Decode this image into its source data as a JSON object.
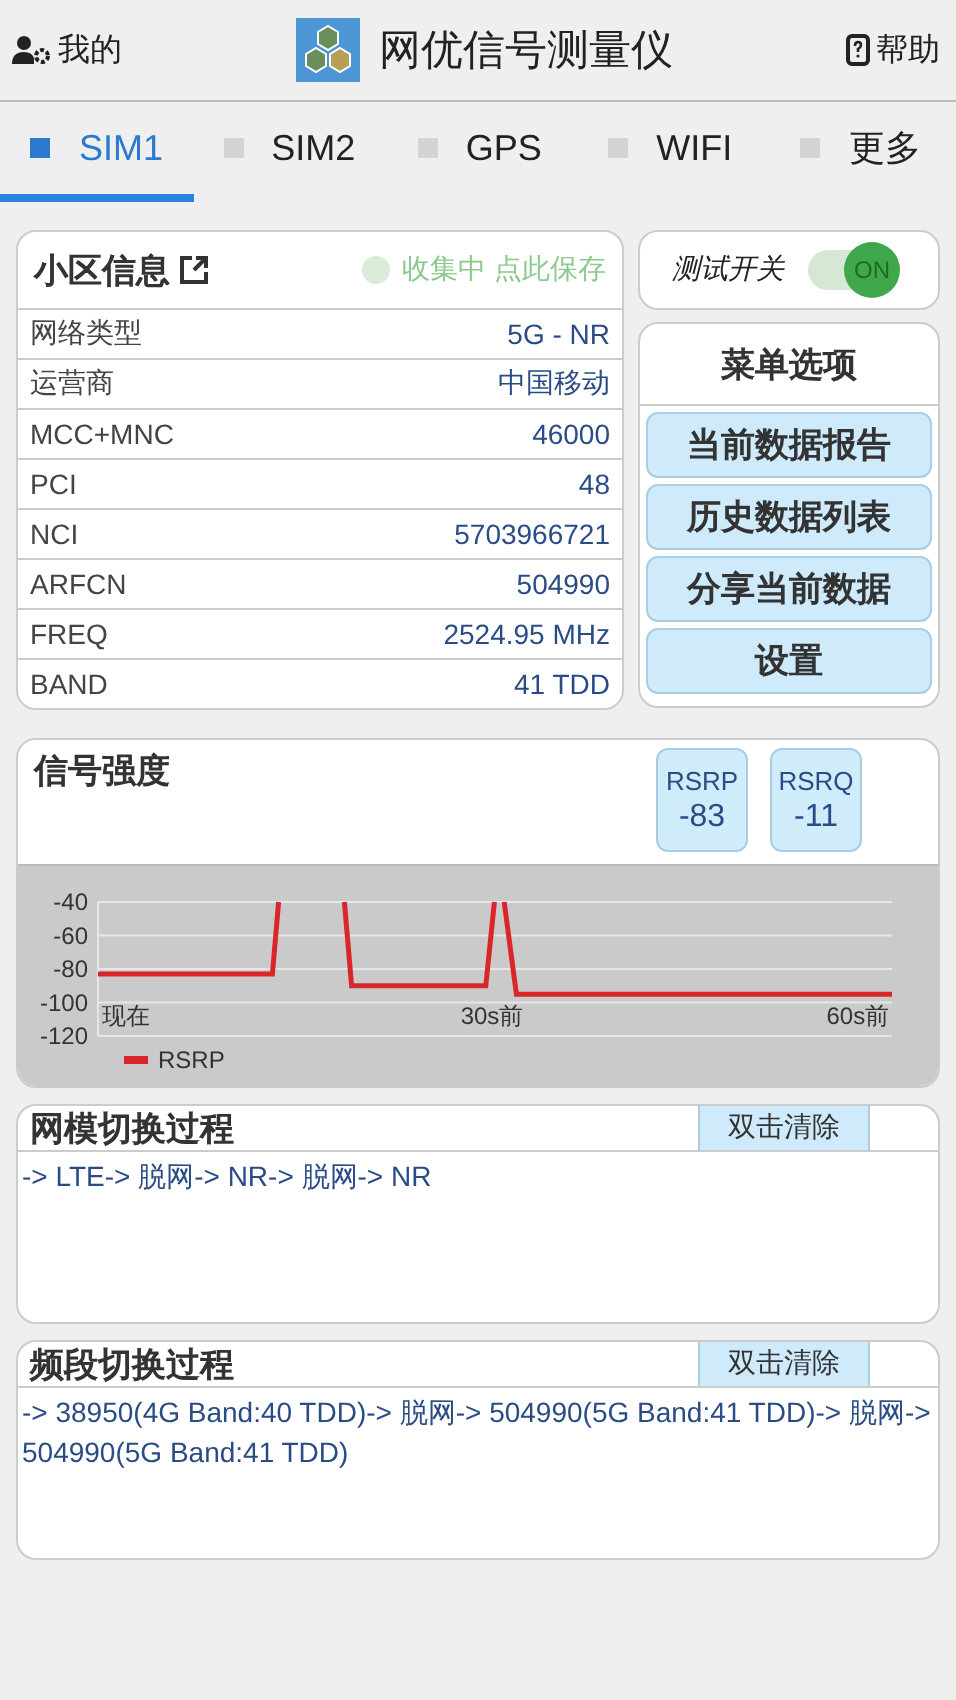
{
  "header": {
    "account": {
      "label": "我的"
    },
    "title": "网优信号测量仪",
    "help": {
      "label": "帮助"
    }
  },
  "tabs": [
    {
      "label": "SIM1",
      "selected": true
    },
    {
      "label": "SIM2",
      "selected": false
    },
    {
      "label": "GPS",
      "selected": false
    },
    {
      "label": "WIFI",
      "selected": false
    },
    {
      "label": "更多",
      "selected": false
    }
  ],
  "cell_info": {
    "title": "小区信息",
    "status": "收集中 点此保存",
    "rows": [
      {
        "label": "网络类型",
        "value": "5G - NR"
      },
      {
        "label": "运营商",
        "value": "中国移动"
      },
      {
        "label": "MCC+MNC",
        "value": "46000"
      },
      {
        "label": "PCI",
        "value": "48"
      },
      {
        "label": "NCI",
        "value": "5703966721"
      },
      {
        "label": "ARFCN",
        "value": "504990"
      },
      {
        "label": "FREQ",
        "value": "2524.95 MHz"
      },
      {
        "label": "BAND",
        "value": "41 TDD"
      }
    ]
  },
  "test_switch": {
    "label": "测试开关",
    "on": true,
    "state_text": "ON"
  },
  "menu": {
    "title": "菜单选项",
    "items": [
      "当前数据报告",
      "历史数据列表",
      "分享当前数据",
      "设置"
    ]
  },
  "signal": {
    "title": "信号强度",
    "readings": [
      {
        "name": "RSRP",
        "value": "-83"
      },
      {
        "name": "RSRQ",
        "value": "-11"
      }
    ],
    "chart_data": {
      "type": "line",
      "grid": true,
      "x": [
        -2.3,
        12,
        12.5,
        17.9,
        18.5,
        29.5,
        30.2,
        31,
        32,
        62.8
      ],
      "series": [
        {
          "name": "RSRP",
          "color": "#d9262b",
          "values": [
            -83,
            -83,
            -40,
            -40,
            -90,
            -90,
            -40,
            -40,
            -95,
            -95
          ]
        }
      ],
      "xlim": [
        -2.3,
        62.8
      ],
      "ylim": [
        -120,
        -40
      ],
      "yticks": [
        -40,
        -60,
        -80,
        -100,
        -120
      ],
      "xticks": [
        {
          "value": 0,
          "label": "现在"
        },
        {
          "value": 30,
          "label": "30s前"
        },
        {
          "value": 60,
          "label": "60s前"
        }
      ]
    }
  },
  "mode_log": {
    "title": "网模切换过程",
    "clear_button": "双击清除",
    "text": "-> LTE-> 脱网-> NR-> 脱网-> NR"
  },
  "band_log": {
    "title": "频段切换过程",
    "clear_button": "双击清除",
    "text": "-> 38950(4G Band:40 TDD)-> 脱网-> 504990(5G Band:41 TDD)-> 脱网-> 504990(5G Band:41 TDD)"
  }
}
